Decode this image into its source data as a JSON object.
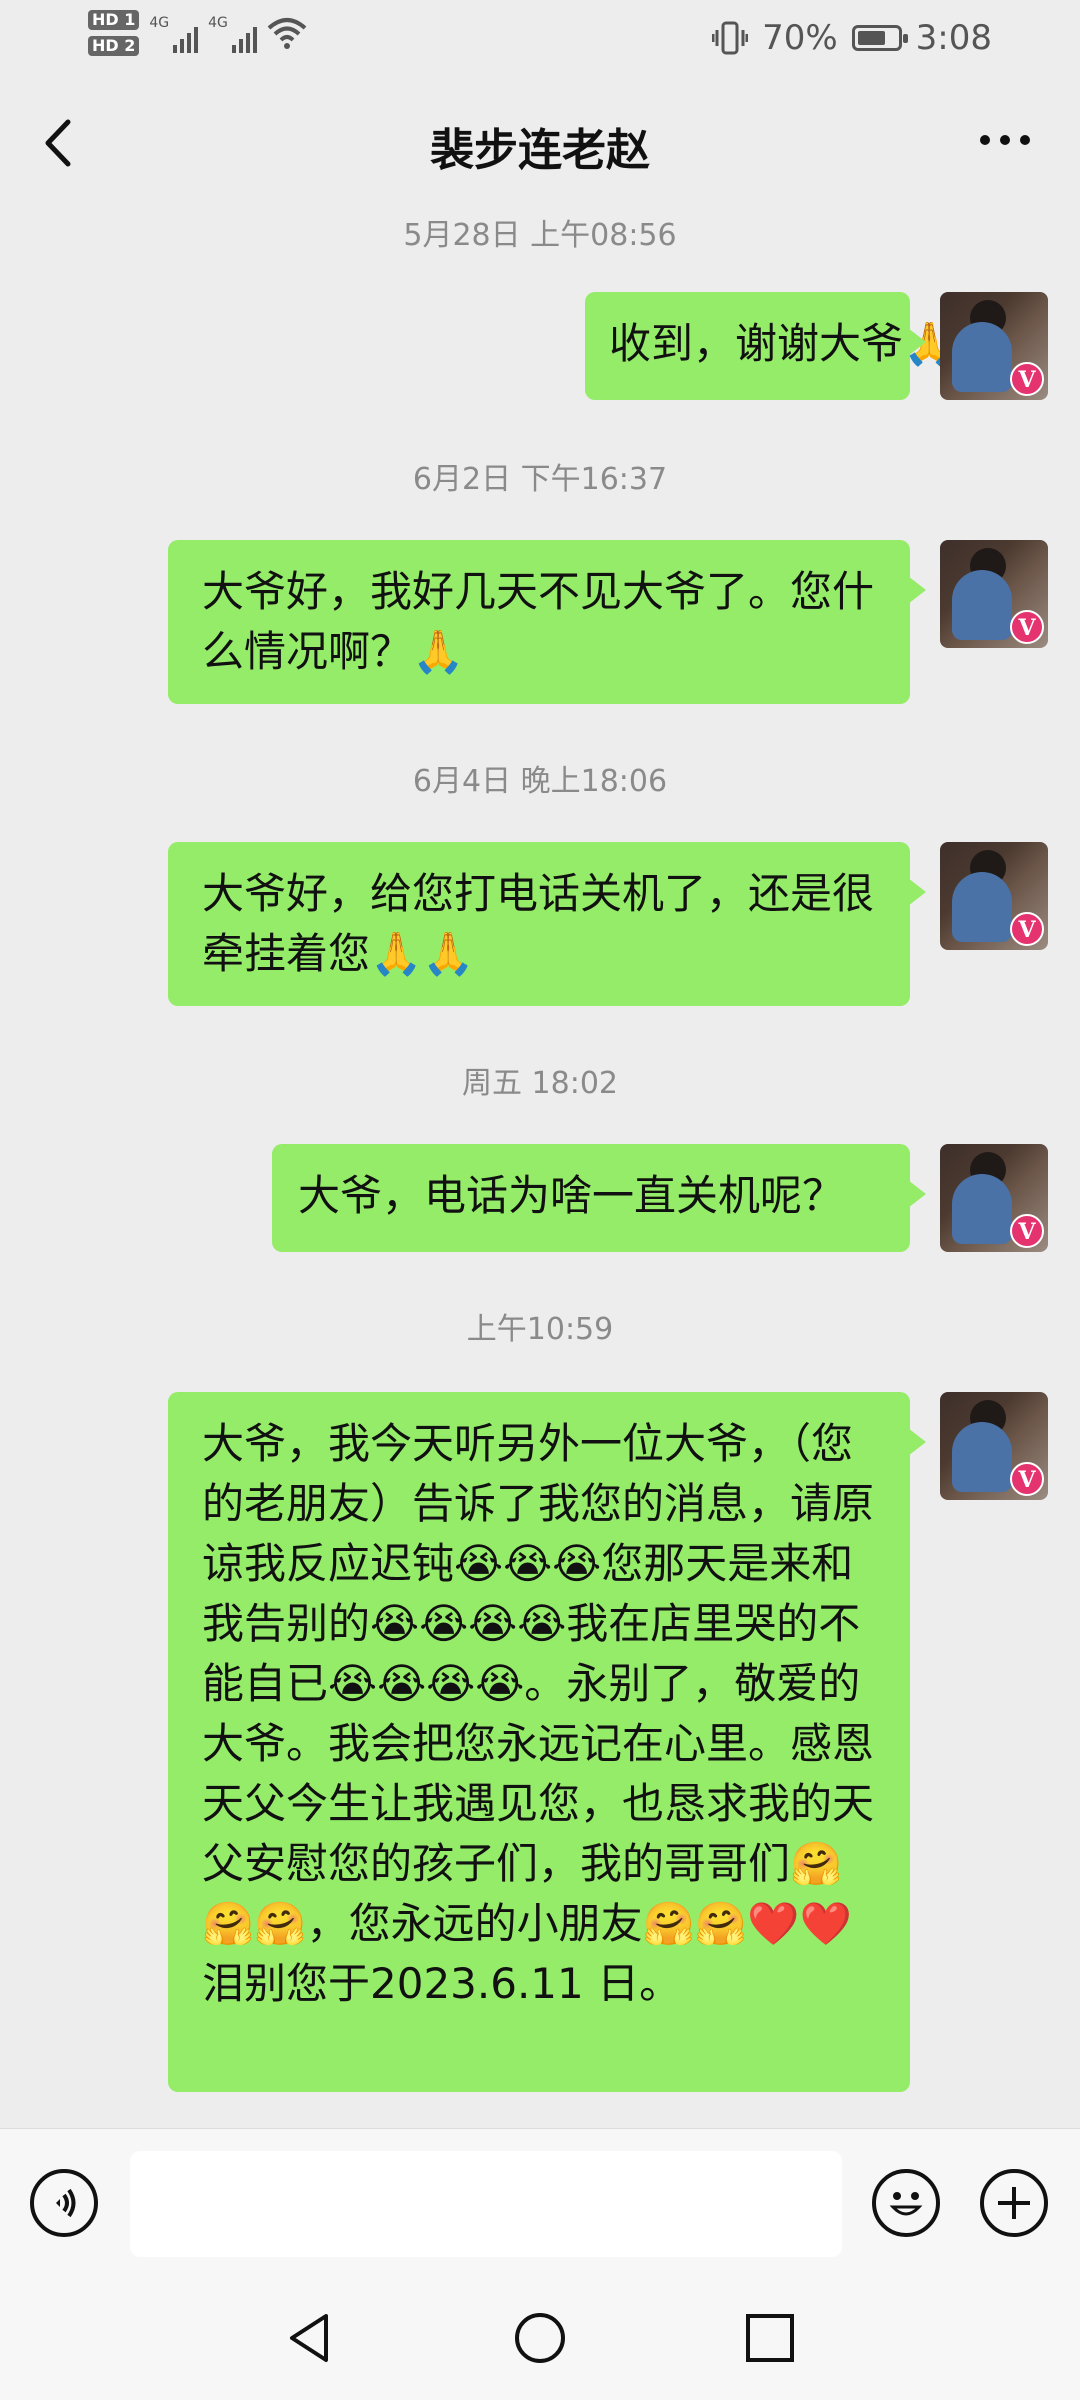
{
  "status": {
    "sim1": "HD 1",
    "sim2": "HD 2",
    "net1": "4G",
    "net2": "4G",
    "battery_text": "70%",
    "battery_level": 0.7,
    "time": "3:08"
  },
  "header": {
    "title": "裴步连老赵",
    "back_icon": "chevron-left-icon",
    "more_icon": "more-dots-icon"
  },
  "messages": [
    {
      "time": "5月28日 上午08:56",
      "text": "收到，谢谢大爷🙏🙏"
    },
    {
      "time": "6月2日 下午16:37",
      "text": "大爷好，我好几天不见大爷了。您什么情况啊？🙏"
    },
    {
      "time": "6月4日 晚上18:06",
      "text": "大爷好，给您打电话关机了，还是很牵挂着您🙏🙏"
    },
    {
      "time": "周五 18:02",
      "text": "大爷，电话为啥一直关机呢？"
    },
    {
      "time": "上午10:59",
      "text": "大爷，我今天听另外一位大爷，（您的老朋友）告诉了我您的消息，请原谅我反应迟钝😭😭😭您那天是来和我告别的😭😭😭😭我在店里哭的不能自已😭😭😭😭。永别了，敬爱的大爷。我会把您永远记在心里。感恩天父今生让我遇见您，也恳求我的天父安慰您的孩子们，我的哥哥们🤗🤗🤗，您永远的小朋友🤗🤗❤️❤️泪别您于2023.6.11 日。"
    }
  ],
  "avatar_badge": "V",
  "input": {
    "placeholder": "",
    "voice_icon": "voice-icon",
    "emoji_icon": "emoji-icon",
    "plus_icon": "plus-icon"
  },
  "nav": {
    "back": "nav-back-icon",
    "home": "nav-home-icon",
    "recents": "nav-recents-icon"
  }
}
